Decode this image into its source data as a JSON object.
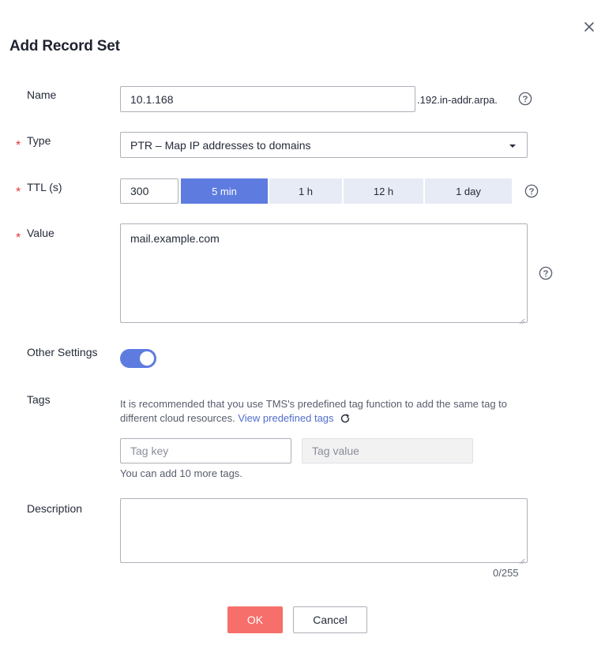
{
  "dialog": {
    "title": "Add Record Set"
  },
  "name_field": {
    "label": "Name",
    "value": "10.1.168",
    "suffix": ".192.in-addr.arpa."
  },
  "type_field": {
    "label": "Type",
    "value": "PTR – Map IP addresses to domains"
  },
  "ttl_field": {
    "label": "TTL (s)",
    "value": "300",
    "options": [
      "5 min",
      "1 h",
      "12 h",
      "1 day"
    ],
    "selected": "5 min"
  },
  "value_field": {
    "label": "Value",
    "value": "mail.example.com"
  },
  "other_settings": {
    "label": "Other Settings",
    "enabled": true
  },
  "tags": {
    "label": "Tags",
    "hint": "It is recommended that you use TMS's predefined tag function to add the same tag to different cloud resources.",
    "link": "View predefined tags",
    "key_placeholder": "Tag key",
    "value_placeholder": "Tag value",
    "remaining": "You can add 10 more tags."
  },
  "description": {
    "label": "Description",
    "value": "",
    "counter": "0/255"
  },
  "buttons": {
    "ok": "OK",
    "cancel": "Cancel"
  },
  "colors": {
    "accent": "#5e7ce0",
    "ok_button": "#f66f6a",
    "required": "#e5393a",
    "link": "#526ecc"
  },
  "icons": {
    "close": "close-icon",
    "help": "help-circle-icon",
    "dropdown": "caret-down-icon",
    "refresh": "refresh-icon"
  }
}
